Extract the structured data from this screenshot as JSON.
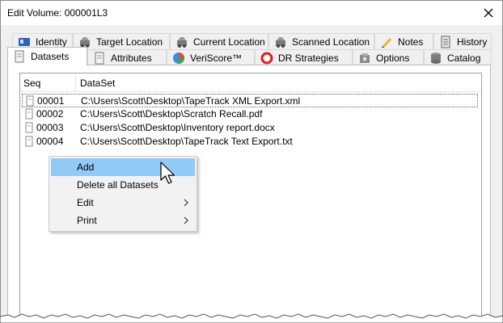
{
  "window": {
    "title": "Edit Volume: 000001L3",
    "close_glyph": "✕"
  },
  "tabs": {
    "row1": [
      {
        "label": "Identity",
        "icon": "identity-icon"
      },
      {
        "label": "Target Location",
        "icon": "target-location-icon"
      },
      {
        "label": "Current Location",
        "icon": "current-location-icon"
      },
      {
        "label": "Scanned Location",
        "icon": "scanned-location-icon"
      },
      {
        "label": "Notes",
        "icon": "notes-icon"
      },
      {
        "label": "History",
        "icon": "history-icon"
      }
    ],
    "row2": [
      {
        "label": "Datasets",
        "icon": "datasets-icon",
        "active": true
      },
      {
        "label": "Attributes",
        "icon": "attributes-icon"
      },
      {
        "label": "VeriScore™",
        "icon": "veriscore-icon"
      },
      {
        "label": "DR Strategies",
        "icon": "dr-strategies-icon"
      },
      {
        "label": "Options",
        "icon": "options-icon"
      },
      {
        "label": "Catalog",
        "icon": "catalog-icon"
      }
    ]
  },
  "list": {
    "columns": [
      "Seq",
      "DataSet"
    ],
    "rows": [
      {
        "seq": "00001",
        "dataset": "C:\\Users\\Scott\\Desktop\\TapeTrack XML Export.xml"
      },
      {
        "seq": "00002",
        "dataset": "C:\\Users\\Scott\\Desktop\\Scratch Recall.pdf"
      },
      {
        "seq": "00003",
        "dataset": "C:\\Users\\Scott\\Desktop\\Inventory report.docx"
      },
      {
        "seq": "00004",
        "dataset": "C:\\Users\\Scott\\Desktop\\TapeTrack Text Export.txt"
      }
    ]
  },
  "context_menu": {
    "items": [
      {
        "label": "Add",
        "submenu": false,
        "highlighted": true
      },
      {
        "label": "Delete all Datasets",
        "submenu": false
      },
      {
        "label": "Edit",
        "submenu": true
      },
      {
        "label": "Print",
        "submenu": true
      }
    ],
    "submenu_glyph": "›"
  },
  "colors": {
    "menu_highlight": "#91c9f7",
    "tab_border": "#bdbdbd",
    "window_bg": "#f0f0f0"
  }
}
